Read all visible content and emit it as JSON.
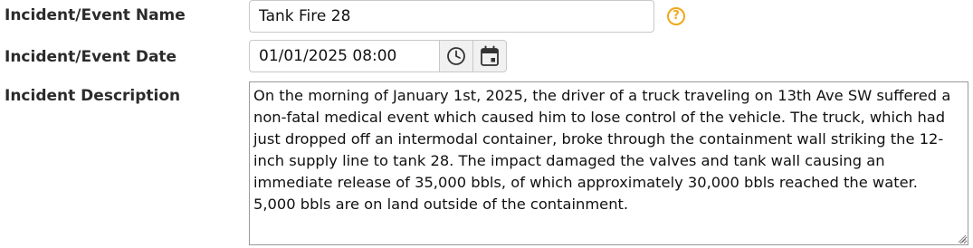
{
  "fields": {
    "name_label": "Incident/Event Name",
    "name_value": "Tank Fire 28",
    "help_glyph": "?",
    "date_label": "Incident/Event Date",
    "date_value": "01/01/2025 08:00",
    "description_label": "Incident Description",
    "description_value": "On the morning of January 1st, 2025, the driver of a truck traveling on 13th Ave SW suffered a non-fatal medical event which caused him to lose control of the vehicle. The truck, which had just dropped off an intermodal container, broke through the containment wall striking the 12-inch supply line to tank 28. The impact damaged the valves and tank wall causing an immediate release of 35,000 bbls, of which approximately 30,000 bbls reached the water. 5,000 bbls are on land outside of the containment."
  },
  "icons": {
    "help": "question-circle-icon",
    "time": "clock-icon",
    "date": "calendar-icon"
  },
  "colors": {
    "help_accent": "#f0a81a",
    "input_border": "#c8c8c8",
    "addon_background": "#f1f1f1",
    "label_text": "#2b2b2b"
  }
}
